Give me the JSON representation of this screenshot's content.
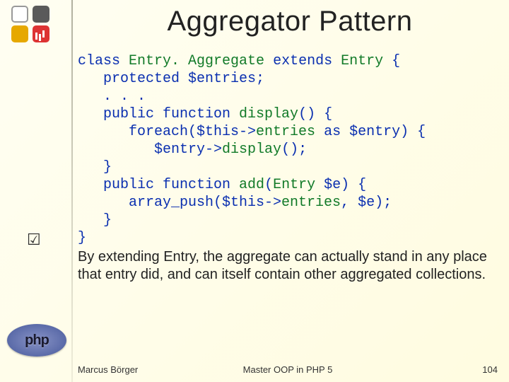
{
  "title": "Aggregator Pattern",
  "code": {
    "l1a": "class ",
    "l1b": "Entry. Aggregate ",
    "l1c": "extends ",
    "l1d": "Entry ",
    "l1e": "{",
    "l2": "   protected $entries;",
    "l3": "   . . .",
    "l4a": "   public function ",
    "l4b": "display",
    "l4c": "() {",
    "l5a": "      foreach($this->",
    "l5b": "entries ",
    "l5c": "as $entry) {",
    "l6a": "         $entry->",
    "l6b": "display",
    "l6c": "();",
    "l7": "   }",
    "l8a": "   public function ",
    "l8b": "add",
    "l8c": "(",
    "l8d": "Entry ",
    "l8e": "$e) {",
    "l9a": "      array_push($this->",
    "l9b": "entries",
    "l9c": ", $e);",
    "l10": "   }",
    "l11": "}"
  },
  "note": "By extending Entry, the aggregate can actually stand in any place that entry did, and can itself contain other aggregated collections.",
  "checkmark": "☑",
  "php_logo_text": "php",
  "footer": {
    "left": "Marcus Börger",
    "center": "Master OOP in PHP 5",
    "right": "104"
  }
}
